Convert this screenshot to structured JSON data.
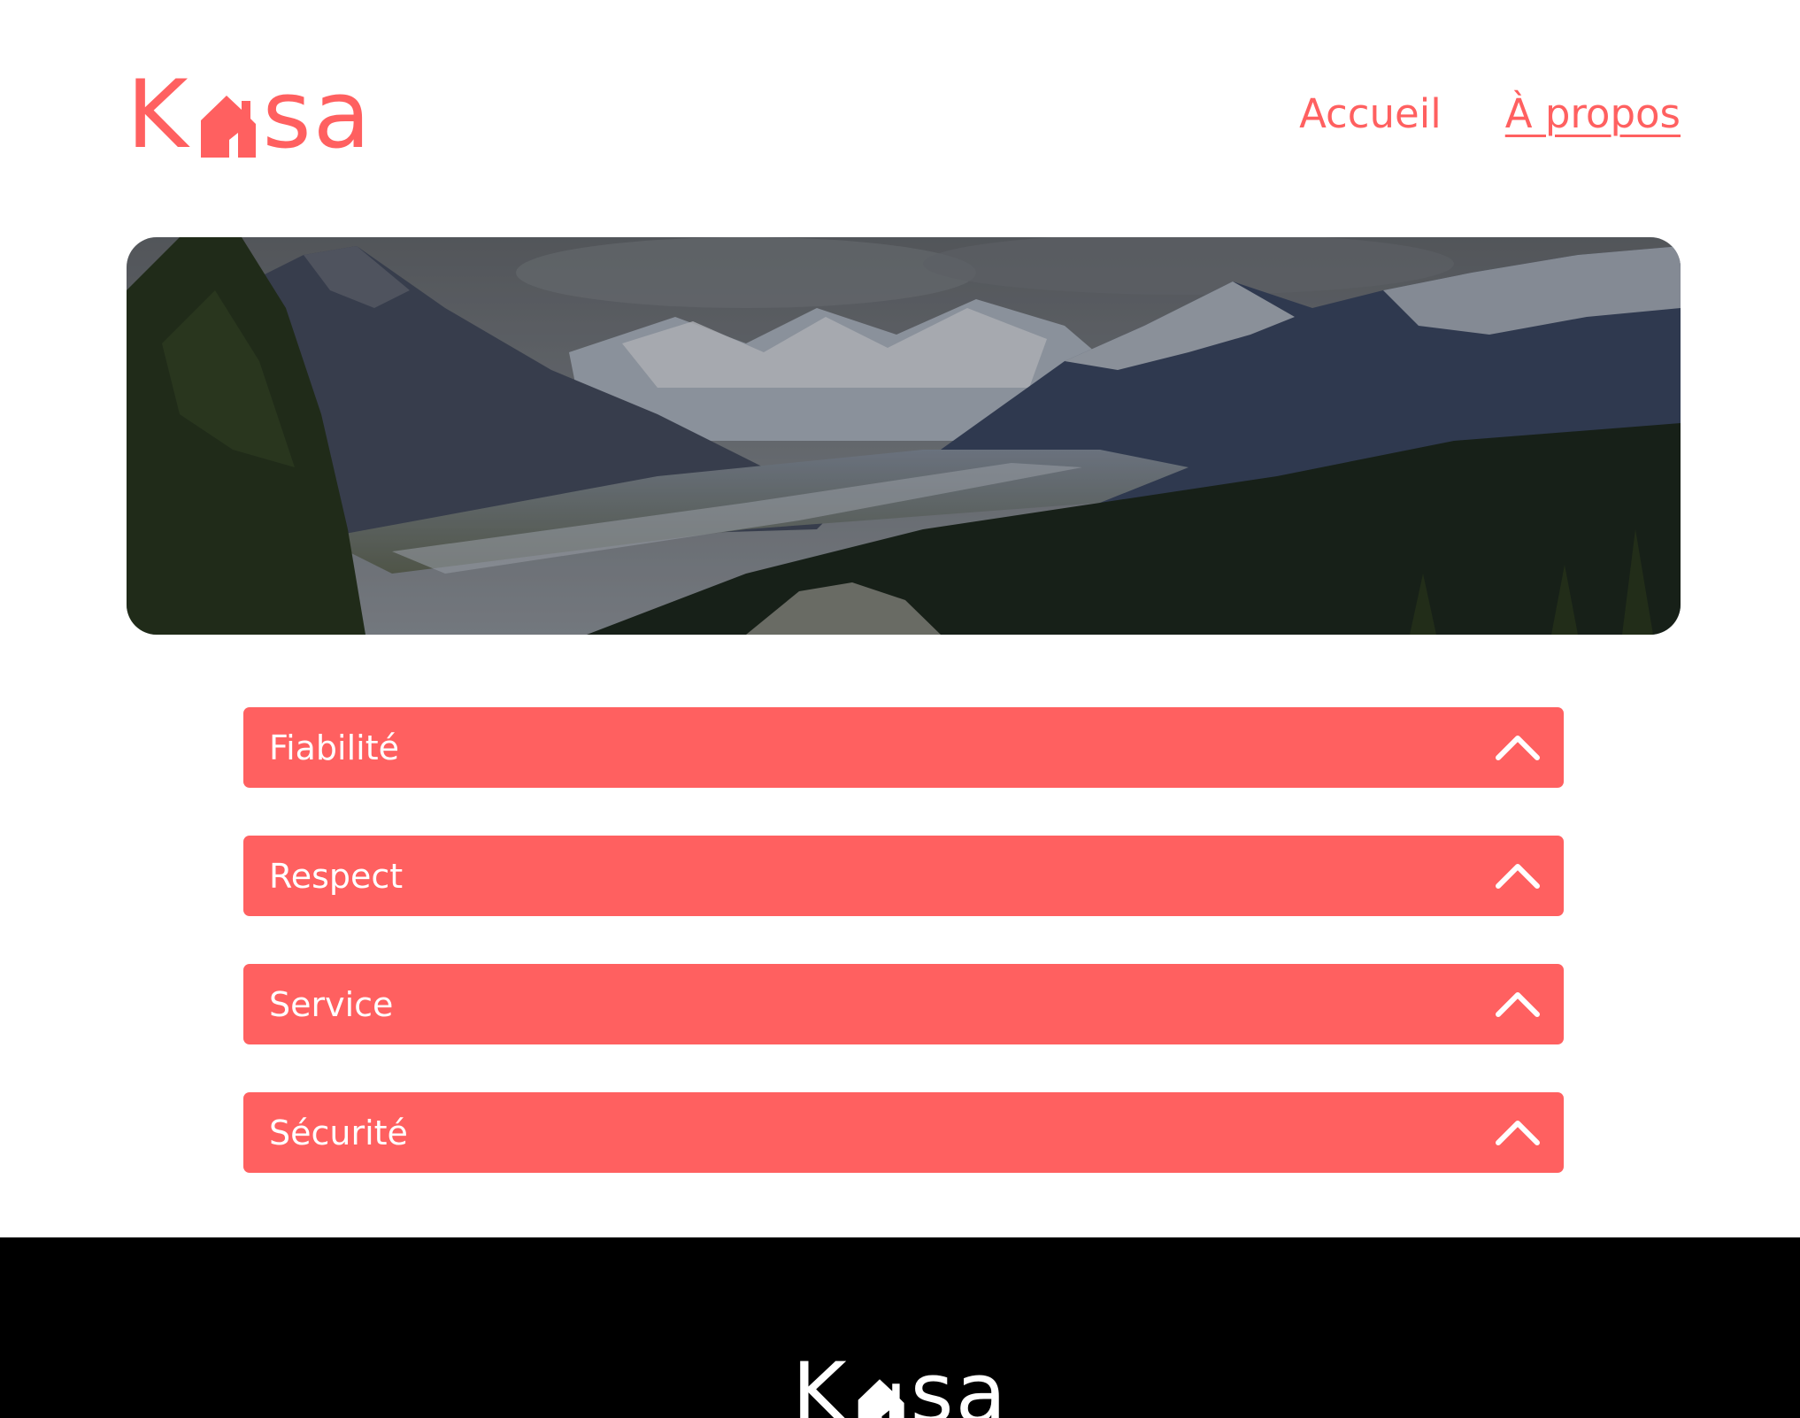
{
  "colors": {
    "brand": "#FF6060",
    "white": "#FFFFFF",
    "footer_bg": "#000000"
  },
  "header": {
    "logo": {
      "letter_k": "K",
      "letters_sa": "sa",
      "house_icon": "house-icon"
    },
    "nav": [
      {
        "label": "Accueil",
        "active": false
      },
      {
        "label": "À propos",
        "active": true
      }
    ]
  },
  "banner": {
    "image": "mountain-landscape"
  },
  "accordion": {
    "items": [
      {
        "title": "Fiabilité",
        "icon": "chevron-up-icon"
      },
      {
        "title": "Respect",
        "icon": "chevron-up-icon"
      },
      {
        "title": "Service",
        "icon": "chevron-up-icon"
      },
      {
        "title": "Sécurité",
        "icon": "chevron-up-icon"
      }
    ]
  },
  "footer": {
    "logo": {
      "letter_k": "K",
      "letters_sa": "sa",
      "house_icon": "house-icon"
    }
  }
}
